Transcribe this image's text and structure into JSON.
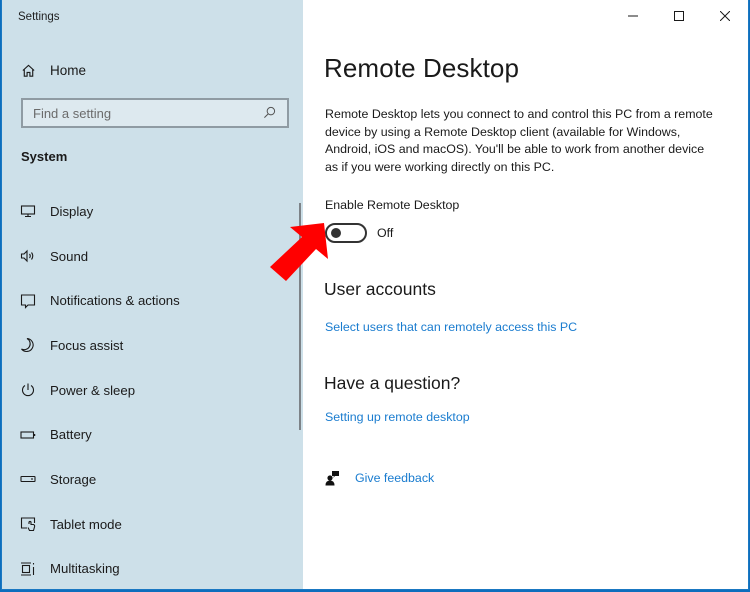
{
  "window": {
    "title": "Settings",
    "controls": {
      "minimize": "minimize",
      "maximize": "maximize",
      "close": "close"
    }
  },
  "sidebar": {
    "home_label": "Home",
    "search": {
      "placeholder": "Find a setting",
      "value": ""
    },
    "section": "System",
    "items": [
      {
        "label": "Display",
        "icon": "display-icon"
      },
      {
        "label": "Sound",
        "icon": "sound-icon"
      },
      {
        "label": "Notifications & actions",
        "icon": "notifications-icon"
      },
      {
        "label": "Focus assist",
        "icon": "focus-assist-icon"
      },
      {
        "label": "Power & sleep",
        "icon": "power-icon"
      },
      {
        "label": "Battery",
        "icon": "battery-icon"
      },
      {
        "label": "Storage",
        "icon": "storage-icon"
      },
      {
        "label": "Tablet mode",
        "icon": "tablet-mode-icon"
      },
      {
        "label": "Multitasking",
        "icon": "multitasking-icon"
      }
    ]
  },
  "main": {
    "title": "Remote Desktop",
    "description": "Remote Desktop lets you connect to and control this PC from a remote device by using a Remote Desktop client (available for Windows, Android, iOS and macOS). You'll be able to work from another device as if you were working directly on this PC.",
    "toggle": {
      "label": "Enable Remote Desktop",
      "state": "Off",
      "on": false
    },
    "user_accounts": {
      "heading": "User accounts",
      "link": "Select users that can remotely access this PC"
    },
    "question": {
      "heading": "Have a question?",
      "link": "Setting up remote desktop"
    },
    "feedback": "Give feedback"
  },
  "colors": {
    "sidebar_bg": "#cde0e9",
    "link": "#1a7ccf",
    "annotation_arrow": "#ff0000",
    "window_border": "#1a78c2"
  }
}
